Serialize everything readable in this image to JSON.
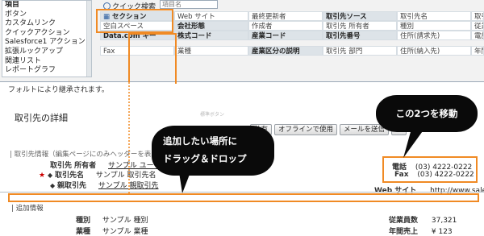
{
  "palette": {
    "categories": [
      "項目",
      "ボタン",
      "カスタムリンク",
      "クイックアクション",
      "Salesforce1 アクション",
      "拡張ルックアップ",
      "関連リスト",
      "レポートグラフ"
    ],
    "quick_find_label": "クイック検索",
    "quick_find_placeholder": "項目名",
    "fields": {
      "r1": [
        "セクション",
        "Web サイト",
        "最終更新者",
        "取引先ソース",
        "取引先名",
        "取引先部門"
      ],
      "r2": [
        "空白スペース",
        "会社形態",
        "作成者",
        "取引先 所有者",
        "種別",
        "従業員数"
      ],
      "r3": [
        "Data.com キー",
        "株式コード",
        "産業コード",
        "取引先番号",
        "住所(請求先)",
        "電話"
      ],
      "r4": [
        "Fax",
        "業種",
        "産業区分の説明",
        "取引先 部門",
        "住所(納入先)",
        "年間売上"
      ]
    }
  },
  "notice": "フォルトにより継承されます。",
  "detail": {
    "title": "取引先の詳細",
    "buttons_label": "標準ボタン",
    "buttons": [
      "共有",
      "オフラインで使用",
      "メールを送信",
      "取"
    ],
    "section_header": "| 取引先情報（編集ページにのみヘッダーを表示",
    "owner_label": "取引先 所有者",
    "owner_value": "サンプル ユーザ",
    "name_label": "取引先名",
    "name_value": "サンプル 取引先名",
    "parent_label": "親取引先",
    "parent_value": "サンプル 親取引先",
    "required_mark": "★",
    "plus_mark": "◆",
    "phone_label": "電話",
    "phone_value": "(03) 4222-0222",
    "fax_label": "Fax",
    "fax_value": "(03) 4222-0222",
    "web_label": "Web サイト",
    "web_value": "http://www.salesforce",
    "additional_header": "| 追加情報",
    "type_label": "種別",
    "type_value": "サンプル 種別",
    "industry_label": "業種",
    "industry_value": "サンプル 業種",
    "employees_label": "従業員数",
    "employees_value": "37,321",
    "revenue_label": "年間売上",
    "revenue_value": "¥ 123"
  },
  "annotations": {
    "callout_drop": "追加したい場所に\nドラッグ＆ドロップ",
    "callout_move": "この2つを移動",
    "accent": "#f08a24"
  }
}
